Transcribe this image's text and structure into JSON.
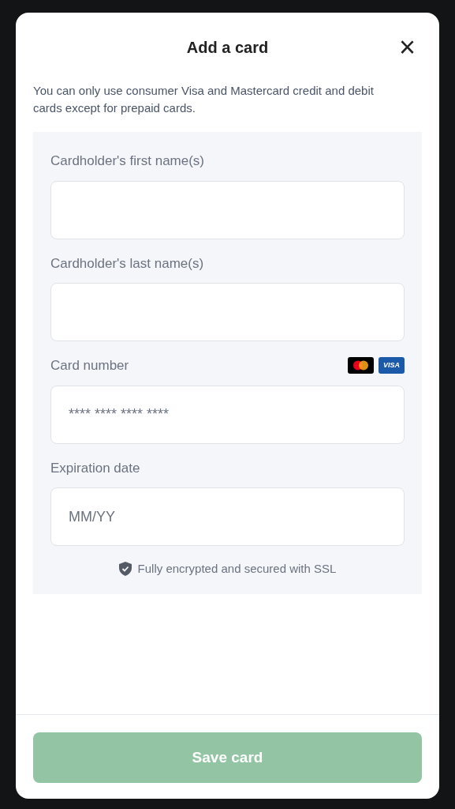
{
  "dialog": {
    "title": "Add a card",
    "close": "×"
  },
  "notice": "You can only use consumer Visa and Mastercard credit and debit cards except for prepaid cards.",
  "fields": [
    {
      "label": "Cardholder's first name(s)"
    },
    {
      "label": "Cardholder's last name(s)"
    },
    {
      "label": "Card number",
      "placeholder": "**** **** **** ****",
      "card_logos": [
        {
          "kind": "mastercard"
        },
        {
          "kind": "visa",
          "text": "VISA"
        }
      ]
    },
    {
      "label": "Expiration date",
      "placeholder": "MM/YY"
    }
  ],
  "security_note": "Fully encrypted and secured with SSL",
  "save_button": {
    "label": "Save card",
    "disabled": true
  }
}
